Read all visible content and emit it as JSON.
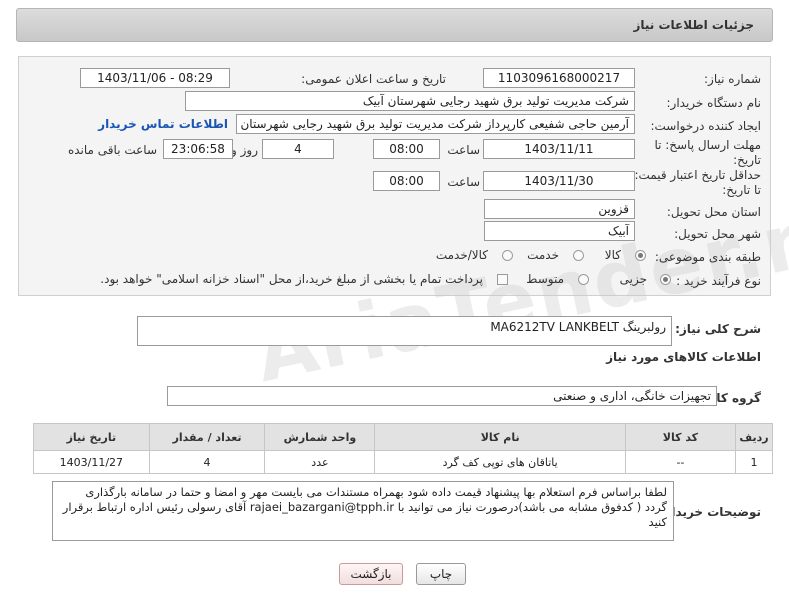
{
  "header": {
    "title": "جزئیات اطلاعات نیاز"
  },
  "form": {
    "need_number": {
      "label": "شماره نیاز:",
      "value": "1103096168000217"
    },
    "announce_datetime": {
      "label": "تاریخ و ساعت اعلان عمومی:",
      "value": "1403/11/06 - 08:29"
    },
    "buyer_org": {
      "label": "نام دستگاه خریدار:",
      "value": "شرکت مدیریت تولید برق شهید رجایی شهرستان آبیک"
    },
    "requester": {
      "label": "ایجاد کننده درخواست:",
      "value": "آرمین حاجی شفیعی کارپرداز شرکت مدیریت تولید برق شهید رجایی شهرستان",
      "contact_link": "اطلاعات تماس خریدار"
    },
    "reply_deadline": {
      "label": "مهلت ارسال پاسخ: تا تاریخ:",
      "date": "1403/11/11",
      "time_label": "ساعت",
      "time": "08:00",
      "days": "4",
      "days_label": "روز و",
      "remaining": "23:06:58",
      "remaining_label": "ساعت باقی مانده"
    },
    "price_validity": {
      "label": "حداقل تاریخ اعتبار قیمت: تا تاریخ:",
      "date": "1403/11/30",
      "time_label": "ساعت",
      "time": "08:00"
    },
    "province": {
      "label": "استان محل تحویل:",
      "value": "قزوین"
    },
    "city": {
      "label": "شهر محل تحویل:",
      "value": "آبیک"
    },
    "category": {
      "label": "طبقه بندی موضوعی:",
      "options": [
        "کالا",
        "خدمت",
        "کالا/خدمت"
      ],
      "selected": "کالا"
    },
    "process_type": {
      "label": "نوع فرآیند خرید :",
      "options": [
        "جزیی",
        "متوسط"
      ],
      "selected": "جزیی",
      "payment_note": "پرداخت تمام یا بخشی از مبلغ خرید،از محل \"اسناد خزانه اسلامی\" خواهد بود."
    }
  },
  "description": {
    "label": "شرح کلی نیاز:",
    "value": "رولبرینگ  MA6212TV  LANKBELT"
  },
  "goods_info": {
    "section_title": "اطلاعات کالاهای مورد نیاز",
    "group_label": "گروه کالا:",
    "group_value": "تجهیزات خانگی، اداری و صنعتی",
    "columns": [
      "ردیف",
      "کد کالا",
      "نام کالا",
      "واحد شمارش",
      "تعداد / مقدار",
      "تاریخ نیاز"
    ],
    "rows": [
      [
        "1",
        "--",
        "یاتاقان های توپی کف گرد",
        "عدد",
        "4",
        "1403/11/27"
      ]
    ]
  },
  "buyer_notes": {
    "label": "توضیحات خریدار:",
    "text": "لطفا براساس فرم استعلام بها پیشنهاد قیمت داده شود بهمراه مستندات می بایست مهر و امضا و حتما در سامانه بارگذاری\nگردد ( کدفوق مشابه می باشد)درصورت نیاز می توانید با rajaei_bazargani@tpph.ir آقای رسولی رئیس  اداره ارتباط برقرار\nکنید"
  },
  "buttons": {
    "print": "چاپ",
    "back": "بازگشت"
  },
  "watermark": "AriaTender.neT"
}
